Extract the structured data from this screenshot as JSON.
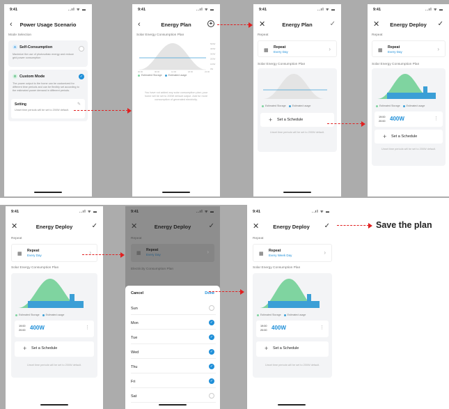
{
  "status": {
    "time": "9:41",
    "icons": "..ıl ᯤ ▬"
  },
  "screen1": {
    "title": "Power Usage Scenario",
    "section": "Mode Selection",
    "self": {
      "title": "Self-Consumption",
      "desc": "Maximize the use of photovoltaic energy and reduce grid power consumption"
    },
    "custom": {
      "title": "Custom Mode",
      "desc": "The power output to the home can be customized for different time periods and can be flexibly set according to the estimated power demand in different periods."
    },
    "setting": {
      "title": "Setting",
      "desc": "Unset time periods will be set to 200W default."
    }
  },
  "screen2": {
    "title": "Energy Plan",
    "chart_label": "Solar Energy Consumption Plan",
    "empty_text": "You have not added any solar consumption plan; your home will be set to 200W default output. Add for more consumption of generated electricity.",
    "y_ticks": [
      "500W",
      "400W",
      "300W",
      "200W",
      "100W",
      "0W"
    ],
    "x_ticks": [
      "00:00",
      "06:00",
      "12:00",
      "18:00",
      "24:00"
    ]
  },
  "screen3": {
    "title": "Energy Plan"
  },
  "screen4": {
    "title": "Energy Deploy"
  },
  "screen5": {
    "title": "Energy Deploy",
    "repeat_value": "Every Day"
  },
  "screen6": {
    "title": "Energy Deploy",
    "chart_label": "Electricity Consumption Plan",
    "sheet": {
      "cancel": "Cancel",
      "done": "Done",
      "days": [
        {
          "name": "Sun",
          "checked": false
        },
        {
          "name": "Mon",
          "checked": true
        },
        {
          "name": "Tue",
          "checked": true
        },
        {
          "name": "Wed",
          "checked": true
        },
        {
          "name": "Thu",
          "checked": true
        },
        {
          "name": "Fri",
          "checked": true
        },
        {
          "name": "Sat",
          "checked": false
        }
      ]
    }
  },
  "screen7": {
    "title": "Energy Deploy",
    "repeat_value": "Every Week Day"
  },
  "common": {
    "repeat_label": "Repeat",
    "repeat_title": "Repeat",
    "repeat_value": "Every Day",
    "chart_label": "Solar Energy Consumption Plan",
    "legend_storage": "Estimated Storage",
    "legend_usage": "Estimated usage",
    "schedule_time": "19:00\n20:00",
    "schedule_power": "400W",
    "set_schedule": "Set a Schedule",
    "default_note": "Unset time periods will be set to 200W default."
  },
  "annotation": {
    "save_plan": "Save the plan"
  },
  "colors": {
    "accent": "#1f8fd8",
    "green": "#7fd4a0",
    "blue_fill": "#3b9fd6",
    "arrow": "#e02020"
  }
}
